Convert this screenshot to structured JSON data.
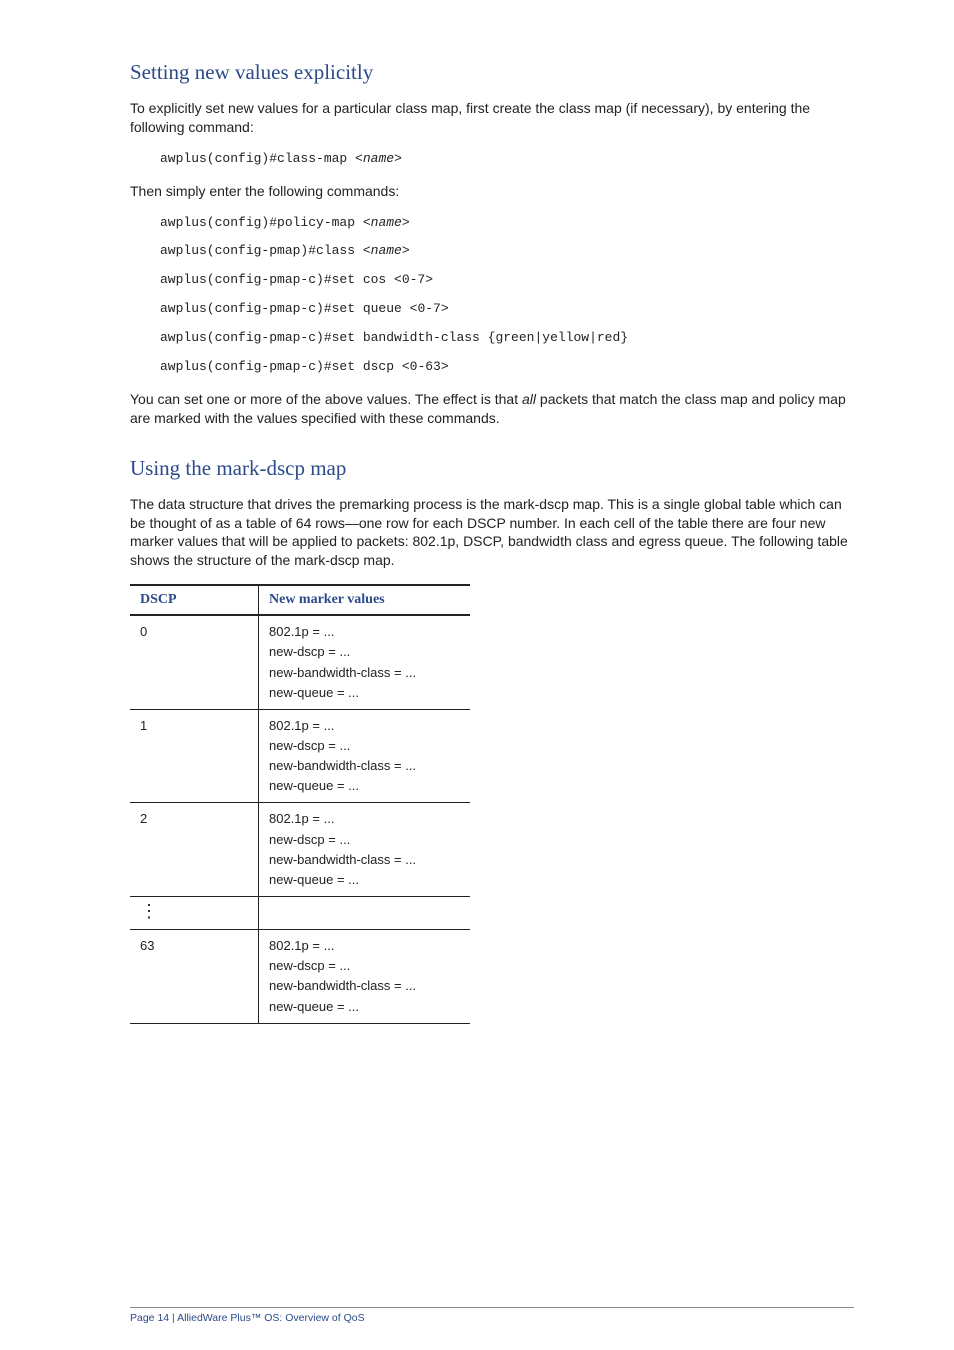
{
  "section1": {
    "heading": "Setting new values explicitly",
    "para1": "To explicitly set new values for a particular class map, first create the class map (if necessary), by entering the following command:",
    "code1": {
      "prefix": "awplus(config)#class-map <",
      "ital": "name",
      "suffix": ">"
    },
    "para2": "Then simply enter the following commands:",
    "code2": [
      {
        "prefix": "awplus(config)#policy-map <",
        "ital": "name",
        "suffix": ">"
      },
      {
        "prefix": "awplus(config-pmap)#class <",
        "ital": "name",
        "suffix": ">"
      },
      {
        "text": "awplus(config-pmap-c)#set cos <0-7>"
      },
      {
        "text": "awplus(config-pmap-c)#set queue <0-7>"
      },
      {
        "text": "awplus(config-pmap-c)#set bandwidth-class {green|yellow|red}"
      },
      {
        "text": "awplus(config-pmap-c)#set dscp <0-63>"
      }
    ],
    "para3a": "You can set one or more of the above values. The effect is that ",
    "para3ital": "all",
    "para3b": " packets that match the class map and policy map are marked with the values specified with these commands."
  },
  "section2": {
    "heading": "Using the mark-dscp map",
    "para1": "The data structure that drives the premarking process is the mark-dscp map. This is a single global table which can be thought of as a table of 64 rows—one row for each DSCP number. In each cell of the table there are four new marker values that will be applied to packets: 802.1p, DSCP, bandwidth class and egress queue. The following table shows the structure of the mark-dscp map."
  },
  "table": {
    "head": {
      "col1": "DSCP",
      "col2": "New marker values"
    },
    "rows": [
      {
        "dscp": "0",
        "l1": "802.1p = ...",
        "l2": "new-dscp = ...",
        "l3": "new-bandwidth-class = ...",
        "l4": "new-queue = ..."
      },
      {
        "dscp": "1",
        "l1": "802.1p = ...",
        "l2": "new-dscp = ...",
        "l3": "new-bandwidth-class = ...",
        "l4": "new-queue = ..."
      },
      {
        "dscp": "2",
        "l1": "802.1p = ...",
        "l2": "new-dscp = ...",
        "l3": "new-bandwidth-class = ...",
        "l4": "new-queue = ..."
      },
      {
        "dscp": "63",
        "l1": "802.1p = ...",
        "l2": "new-dscp = ...",
        "l3": "new-bandwidth-class = ...",
        "l4": "new-queue = ..."
      }
    ]
  },
  "footer": "Page 14 | AlliedWare Plus™ OS: Overview of QoS"
}
